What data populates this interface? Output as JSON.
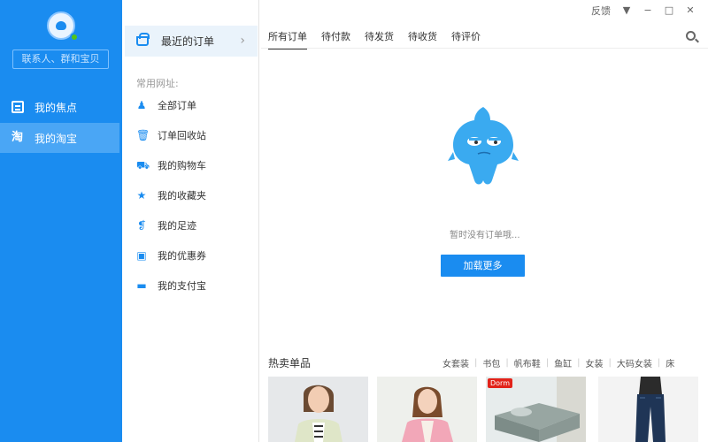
{
  "sidebar": {
    "search_placeholder": "联系人、群和宝贝",
    "items": [
      {
        "label": "我的焦点"
      },
      {
        "label": "我的淘宝"
      }
    ]
  },
  "menu": {
    "recent_orders": "最近的订单",
    "section_title": "常用网址:",
    "items": [
      {
        "label": "全部订单",
        "icon": "bell-icon"
      },
      {
        "label": "订单回收站",
        "icon": "trash-icon"
      },
      {
        "label": "我的购物车",
        "icon": "cart-icon"
      },
      {
        "label": "我的收藏夹",
        "icon": "star-icon"
      },
      {
        "label": "我的足迹",
        "icon": "footprint-icon"
      },
      {
        "label": "我的优惠券",
        "icon": "coupon-icon"
      },
      {
        "label": "我的支付宝",
        "icon": "wallet-icon"
      }
    ]
  },
  "titlebar": {
    "feedback": "反馈"
  },
  "tabs": [
    {
      "label": "所有订单"
    },
    {
      "label": "待付款"
    },
    {
      "label": "待发货"
    },
    {
      "label": "待收货"
    },
    {
      "label": "待评价"
    }
  ],
  "empty_state": {
    "message": "暂时没有订单哦...",
    "load_more": "加载更多"
  },
  "hot": {
    "title": "热卖单品",
    "categories": [
      "女套装",
      "书包",
      "帆布鞋",
      "鱼缸",
      "女装",
      "大码女装",
      "床"
    ]
  },
  "products": [
    {
      "badge": ""
    },
    {
      "badge": ""
    },
    {
      "badge": "Dorm"
    },
    {
      "badge": ""
    }
  ],
  "colors": {
    "accent": "#1a8cf0",
    "sidebar_active": "#4aa6f5",
    "menu_highlight": "#eaf3fb"
  }
}
